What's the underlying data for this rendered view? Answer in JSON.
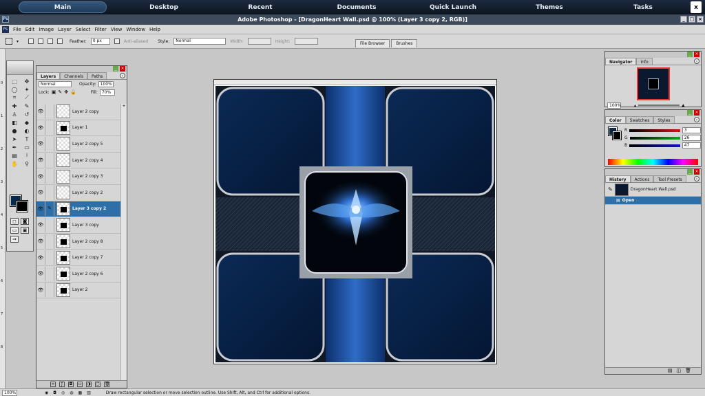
{
  "topnav": {
    "tabs": [
      "Main",
      "Desktop",
      "Recent",
      "Documents",
      "Quick Launch",
      "Themes",
      "Tasks"
    ],
    "close": "x"
  },
  "titlebar": {
    "title": "Adobe Photoshop - [DragonHeart Wall.psd @ 100% (Layer 3 copy 2, RGB)]"
  },
  "menu": [
    "File",
    "Edit",
    "Image",
    "Layer",
    "Select",
    "Filter",
    "View",
    "Window",
    "Help"
  ],
  "options": {
    "feather_label": "Feather:",
    "feather_value": "0 px",
    "antialiased": "Anti-aliased",
    "style_label": "Style:",
    "style_value": "Normal",
    "width_label": "Width:",
    "height_label": "Height:",
    "wells": [
      "File Browser",
      "Brushes"
    ]
  },
  "ruler": [
    "0",
    "1",
    "2",
    "3",
    "4",
    "5",
    "6",
    "7",
    "8"
  ],
  "layers_panel": {
    "tabs": [
      "Layers",
      "Channels",
      "Paths"
    ],
    "blend_mode": "Normal",
    "opacity_label": "Opacity:",
    "opacity_value": "100%",
    "lock_label": "Lock:",
    "fill_label": "Fill:",
    "fill_value": "70%",
    "layers": [
      {
        "name": "Layer 2 copy",
        "visible": true,
        "mark": false
      },
      {
        "name": "Layer 1",
        "visible": true,
        "mark": true
      },
      {
        "name": "Layer 2 copy 5",
        "visible": true,
        "mark": false
      },
      {
        "name": "Layer 2 copy 4",
        "visible": true,
        "mark": false
      },
      {
        "name": "Layer 2 copy 3",
        "visible": true,
        "mark": false
      },
      {
        "name": "Layer 2 copy 2",
        "visible": true,
        "mark": false
      },
      {
        "name": "Layer 3 copy 2",
        "visible": true,
        "mark": true,
        "selected": true
      },
      {
        "name": "Layer 3 copy",
        "visible": true,
        "mark": true
      },
      {
        "name": "Layer 2 copy 8",
        "visible": true,
        "mark": true
      },
      {
        "name": "Layer 2 copy 7",
        "visible": true,
        "mark": true
      },
      {
        "name": "Layer 2 copy 6",
        "visible": true,
        "mark": true
      },
      {
        "name": "Layer 2",
        "visible": true,
        "mark": true
      }
    ]
  },
  "navigator": {
    "tabs": [
      "Navigator",
      "Info"
    ],
    "zoom": "100%"
  },
  "color_panel": {
    "tabs": [
      "Color",
      "Swatches",
      "Styles"
    ],
    "channels": [
      {
        "label": "R",
        "value": "3",
        "color": "#d11"
      },
      {
        "label": "G",
        "value": "26",
        "color": "#1a1"
      },
      {
        "label": "B",
        "value": "47",
        "color": "#11c"
      }
    ],
    "foreground": "#03294e",
    "background": "#000000"
  },
  "history_panel": {
    "tabs": [
      "History",
      "Actions",
      "Tool Presets"
    ],
    "snapshot": "DragonHeart Wall.psd",
    "items": [
      "Open"
    ]
  },
  "status": {
    "zoom": "100%",
    "message": "Draw rectangular selection or move selection outline.  Use Shift, Alt, and Ctrl for additional options."
  }
}
